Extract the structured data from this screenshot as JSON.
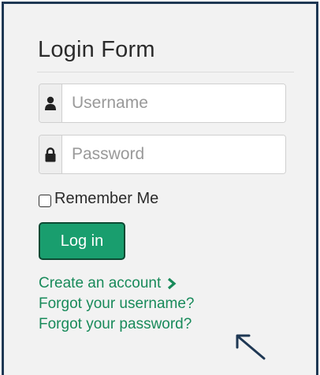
{
  "form": {
    "title": "Login Form",
    "username_placeholder": "Username",
    "password_placeholder": "Password",
    "remember_label": "Remember Me",
    "remember_checked": false,
    "login_label": "Log in"
  },
  "links": {
    "create_account": "Create an account",
    "forgot_username": "Forgot your username?",
    "forgot_password": "Forgot your password?"
  },
  "icons": {
    "user": "user-icon",
    "lock": "lock-icon",
    "chevron": "chevron-right-icon",
    "annotation": "arrow-annotation-icon"
  },
  "colors": {
    "frame_border": "#1f3854",
    "panel_bg": "#f2f2f2",
    "button_bg": "#199e6e",
    "link": "#188a5a"
  }
}
